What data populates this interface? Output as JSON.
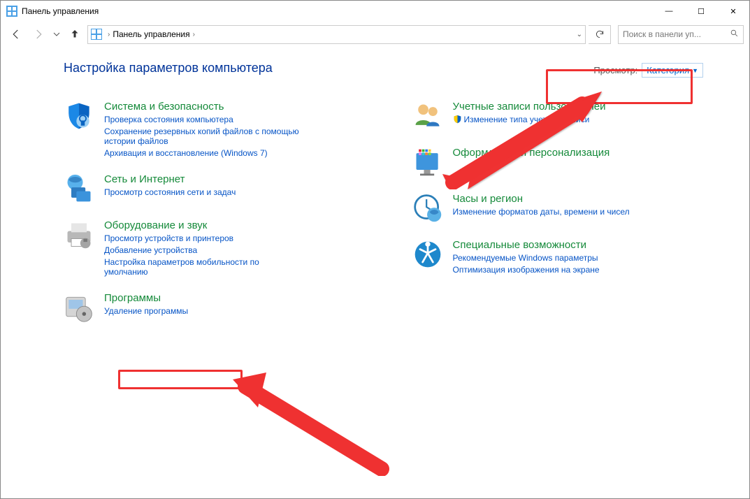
{
  "window": {
    "title": "Панель управления",
    "minimize": "—",
    "maximize": "☐",
    "close": "✕"
  },
  "breadcrumb": {
    "root_icon": "control-panel-icon",
    "item1": "Панель управления"
  },
  "search": {
    "placeholder": "Поиск в панели уп..."
  },
  "header": {
    "title": "Настройка параметров компьютера",
    "view_label": "Просмотр:",
    "view_value": "Категория"
  },
  "left_categories": [
    {
      "icon": "shield-blue",
      "title": "Система и безопасность",
      "links": [
        "Проверка состояния компьютера",
        "Сохранение резервных копий файлов с помощью истории файлов",
        "Архивация и восстановление (Windows 7)"
      ]
    },
    {
      "icon": "network-globe",
      "title": "Сеть и Интернет",
      "links": [
        "Просмотр состояния сети и задач"
      ]
    },
    {
      "icon": "printer",
      "title": "Оборудование и звук",
      "links": [
        "Просмотр устройств и принтеров",
        "Добавление устройства",
        "Настройка параметров мобильности по умолчанию"
      ]
    },
    {
      "icon": "programs-box",
      "title": "Программы",
      "links": [
        "Удаление программы"
      ]
    }
  ],
  "right_categories": [
    {
      "icon": "people",
      "title": "Учетные записи пользователей",
      "links": [
        "Изменение типа учетной записи"
      ],
      "shield": true
    },
    {
      "icon": "desktop-colors",
      "title": "Оформление и персонализация",
      "links": []
    },
    {
      "icon": "clock-globe",
      "title": "Часы и регион",
      "links": [
        "Изменение форматов даты, времени и чисел"
      ]
    },
    {
      "icon": "ease-of-access",
      "title": "Специальные возможности",
      "links": [
        "Рекомендуемые Windows параметры",
        "Оптимизация изображения на экране"
      ]
    }
  ]
}
